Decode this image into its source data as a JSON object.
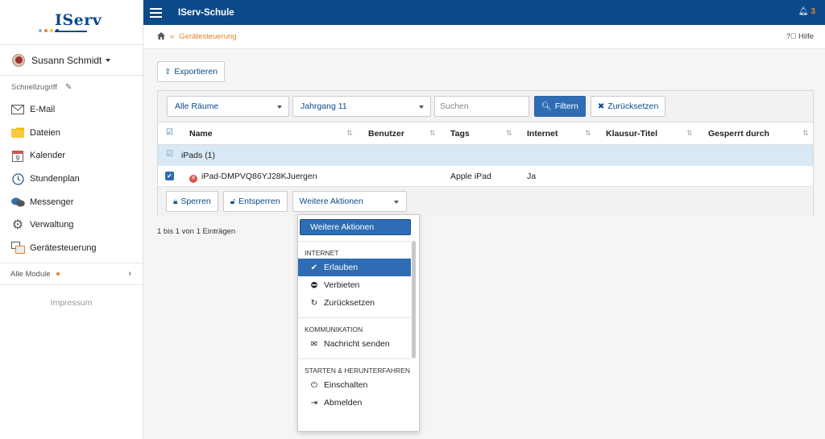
{
  "sidebar": {
    "logo": "IServ",
    "user": "Susann Schmidt",
    "quick_access": "Schnellzugriff",
    "items": [
      {
        "label": "E-Mail",
        "icon": "envelope-icon"
      },
      {
        "label": "Dateien",
        "icon": "folder-icon"
      },
      {
        "label": "Kalender",
        "icon": "calendar-icon"
      },
      {
        "label": "Stundenplan",
        "icon": "clock-icon"
      },
      {
        "label": "Messenger",
        "icon": "chat-icon"
      },
      {
        "label": "Verwaltung",
        "icon": "gear-icon"
      },
      {
        "label": "Gerätesteuerung",
        "icon": "devices-icon"
      }
    ],
    "all_modules": "Alle Module",
    "impressum": "Impressum",
    "calendar_day": "9"
  },
  "topbar": {
    "title": "IServ-Schule",
    "notifications": "3"
  },
  "breadcrumb": {
    "current": "Gerätesteuerung",
    "help": "Hilfe"
  },
  "toolbar": {
    "export": "Exportieren"
  },
  "filters": {
    "rooms": "Alle Räume",
    "year": "Jahrgang 11",
    "search_placeholder": "Suchen",
    "filter": "Filtern",
    "reset": "Zurücksetzen"
  },
  "table": {
    "columns": [
      "Name",
      "Benutzer",
      "Tags",
      "Internet",
      "Klausur-Titel",
      "Gesperrt durch"
    ],
    "group": {
      "name": "iPads",
      "count": "(1)"
    },
    "rows": [
      {
        "name": "iPad-DMPVQ86YJ28KJuergen",
        "user": "",
        "tags": "Apple iPad",
        "internet": "Ja",
        "exam": "",
        "locked_by": ""
      }
    ]
  },
  "actions": {
    "lock": "Sperren",
    "unlock": "Entsperren",
    "more": "Weitere Aktionen"
  },
  "entries_info": "1 bis 1 von 1 Einträgen",
  "dropdown": {
    "header": "Weitere Aktionen",
    "internet_cat": "INTERNET",
    "allow": "Erlauben",
    "deny": "Verbieten",
    "reset": "Zurücksetzen",
    "comm_cat": "KOMMUNIKATION",
    "send_message": "Nachricht senden",
    "power_cat": "STARTEN & HERUNTERFAHREN",
    "power_on": "Einschalten",
    "logout": "Abmelden"
  },
  "colors": {
    "primary": "#0b4a8b",
    "accent": "#e8822a",
    "button_blue": "#2e6db4",
    "group_row": "#d9e8f5"
  }
}
